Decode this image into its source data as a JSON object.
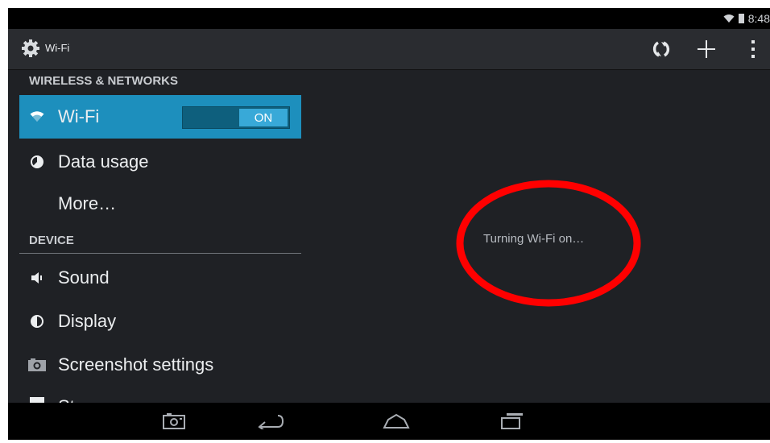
{
  "status_bar": {
    "time": "8:48"
  },
  "action_bar": {
    "title": "Wi-Fi"
  },
  "left_pane": {
    "wireless_header": "WIRELESS & NETWORKS",
    "device_header": "DEVICE",
    "wifi_item": {
      "label": "Wi-Fi",
      "toggle_label": "ON"
    },
    "data_usage_label": "Data usage",
    "more_label": "More…",
    "sound_label": "Sound",
    "display_label": "Display",
    "screenshot_label": "Screenshot settings",
    "storage_label": "Storage"
  },
  "main_pane": {
    "status_message": "Turning Wi-Fi on…"
  },
  "colors": {
    "accent": "#1d8fbd",
    "toggle_on": "#38a9d8",
    "background": "#1f2125",
    "annotation": "#ff0000"
  },
  "icons": {
    "status": [
      "wifi-icon",
      "battery-icon"
    ],
    "action_bar": [
      "settings-gear-icon",
      "wps-icon",
      "add-icon",
      "overflow-menu-icon"
    ],
    "navigation": [
      "screenshot-icon",
      "back-icon",
      "home-icon",
      "recents-icon"
    ]
  }
}
